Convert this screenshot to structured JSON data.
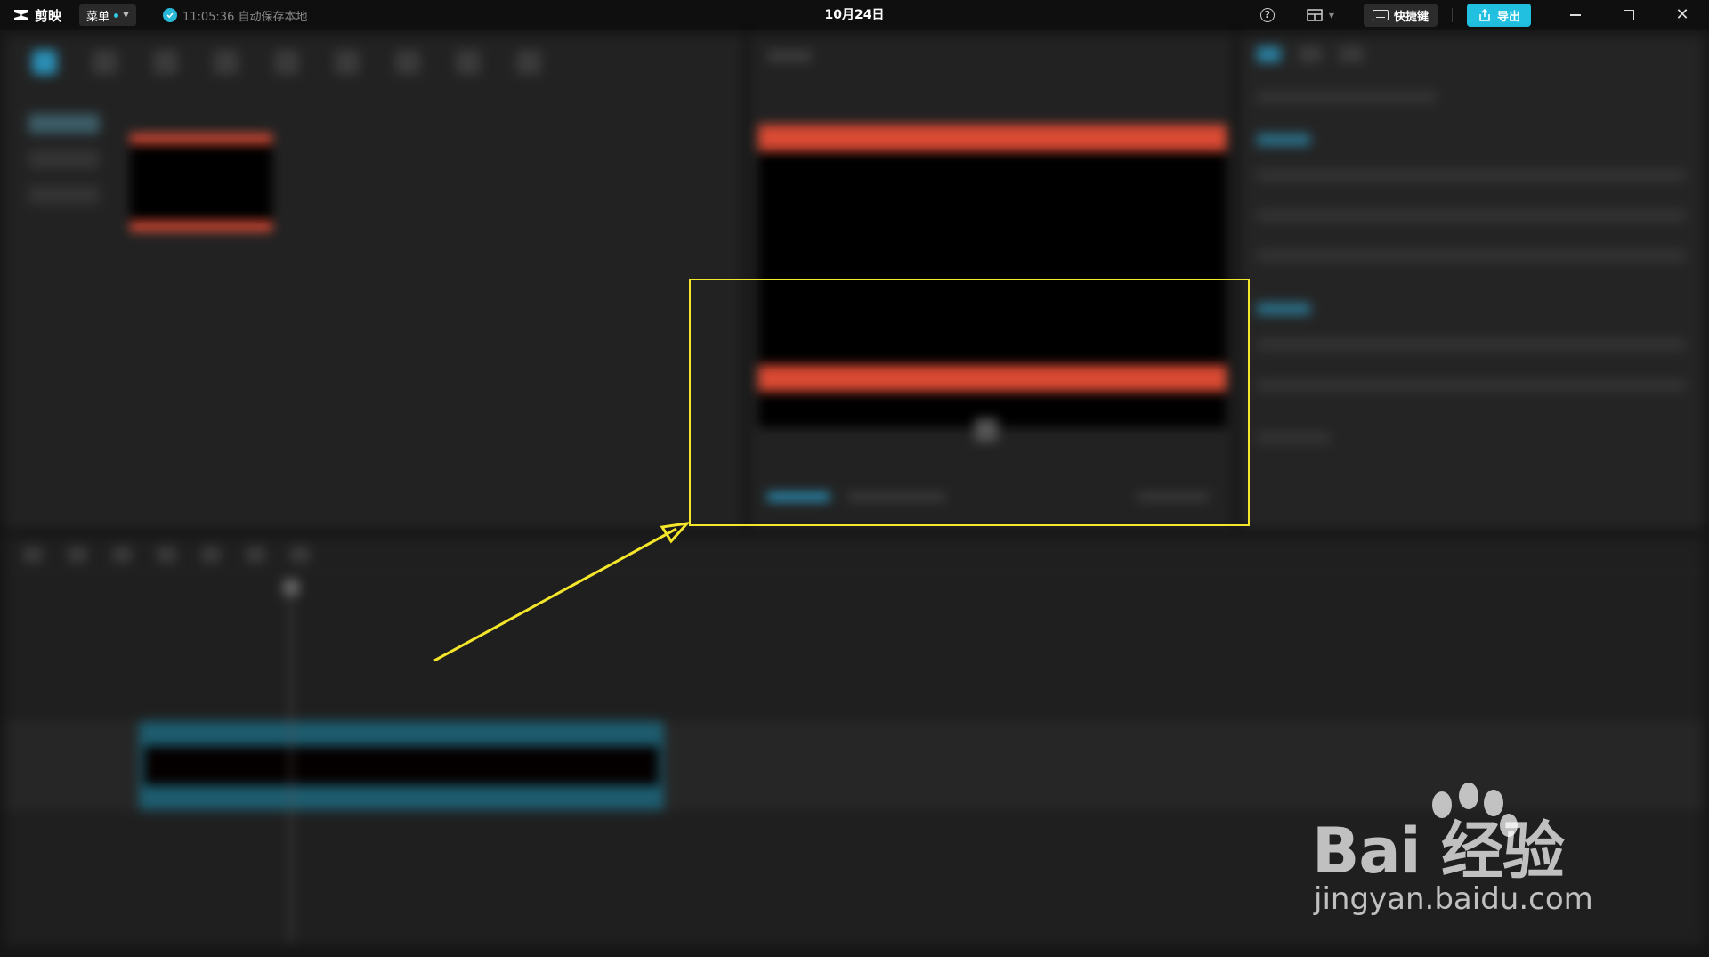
{
  "app": {
    "name": "剪映",
    "menu_label": "菜单",
    "autosave_text": "11:05:36 自动保存本地",
    "project_title": "10月24日"
  },
  "titlebar": {
    "help_icon": "help-circle-icon",
    "layout_icon": "layout-icon",
    "shortcut_label": "快捷键",
    "export_label": "导出"
  },
  "colors": {
    "accent": "#21c0e0",
    "highlight": "#f4e62a",
    "red_bar": "#d94a33",
    "clip": "#1d5c6e"
  },
  "watermark": {
    "brand": "Bai  经验",
    "url": "jingyan.baidu.com"
  }
}
